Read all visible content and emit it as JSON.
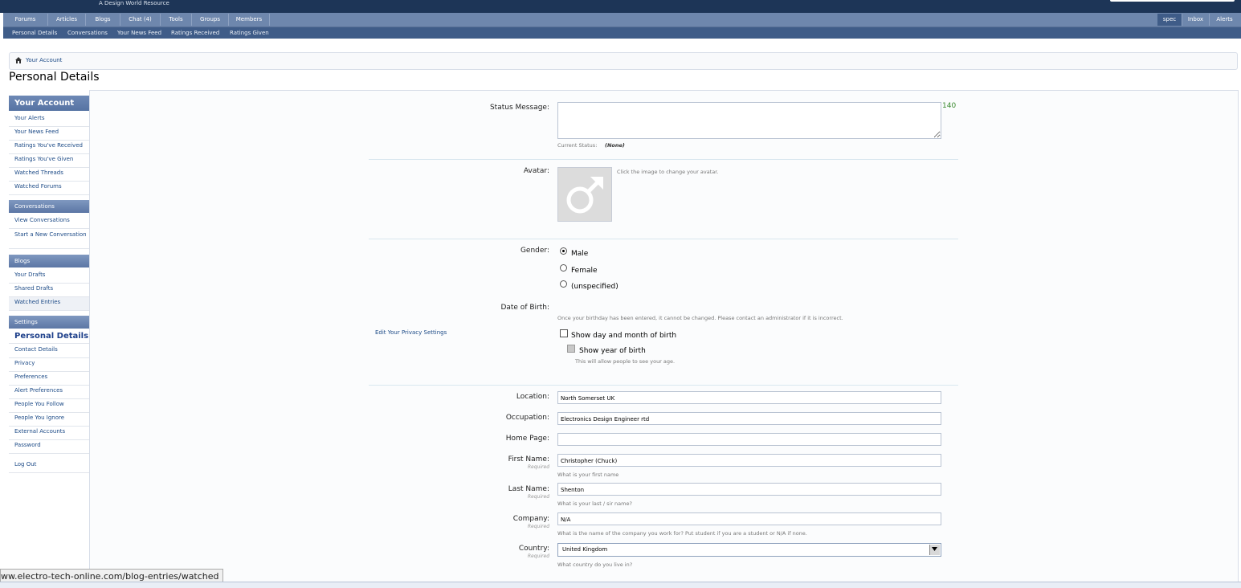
{
  "header": {
    "tagline": "A Design World Resource"
  },
  "nav": {
    "tabs": [
      "Forums",
      "Articles",
      "Blogs",
      "Chat (4)",
      "Tools",
      "Groups",
      "Members"
    ],
    "user_tabs": [
      "spec",
      "Inbox",
      "Alerts"
    ],
    "subnav": [
      "Personal Details",
      "Conversations",
      "Your News Feed",
      "Ratings Received",
      "Ratings Given"
    ]
  },
  "breadcrumb": {
    "label": "Your Account",
    "icon": "home-icon"
  },
  "page": {
    "title": "Personal Details"
  },
  "sidebar": {
    "heading": "Your Account",
    "account_items": [
      "Your Alerts",
      "Your News Feed",
      "Ratings You've Received",
      "Ratings You've Given",
      "Watched Threads",
      "Watched Forums"
    ],
    "conv_heading": "Conversations",
    "conv_items": [
      "View Conversations",
      "Start a New Conversation"
    ],
    "blogs_heading": "Blogs",
    "blog_items": [
      "Your Drafts",
      "Shared Drafts",
      "Watched Entries"
    ],
    "settings_heading": "Settings",
    "settings_selected": "Personal Details",
    "settings_items": [
      "Contact Details",
      "Privacy",
      "Preferences",
      "Alert Preferences",
      "People You Follow",
      "People You Ignore",
      "External Accounts",
      "Password"
    ],
    "logout": "Log Out"
  },
  "form": {
    "status_label": "Status Message:",
    "status_counter": "140",
    "current_status_label": "Current Status:",
    "current_status_value": "(None)",
    "avatar_label": "Avatar:",
    "avatar_hint": "Click the image to change your avatar.",
    "gender_label": "Gender:",
    "gender_options": [
      "Male",
      "Female",
      "(unspecified)"
    ],
    "gender_selected": "Male",
    "dob_label": "Date of Birth:",
    "dob_hint": "Once your birthday has been entered, it cannot be changed. Please contact an administrator if it is incorrect.",
    "privacy_link": "Edit Your Privacy Settings",
    "show_dm": "Show day and month of birth",
    "show_year": "Show year of birth",
    "show_year_hint": "This will allow people to see your age.",
    "location_label": "Location:",
    "location_value": "North Somerset UK",
    "occupation_label": "Occupation:",
    "occupation_value": "Electronics Design Engineer rtd",
    "homepage_label": "Home Page:",
    "homepage_value": "",
    "firstname_label": "First Name:",
    "firstname_value": "Christopher (Chuck)",
    "firstname_hint": "What is your first name",
    "lastname_label": "Last Name:",
    "lastname_value": "Shenton",
    "lastname_hint": "What is your last / sir name?",
    "company_label": "Company:",
    "company_value": "N/A",
    "company_hint": "What is the name of the company you work for? Put student if you are a student or N/A if none.",
    "country_label": "Country:",
    "country_value": "United Kingdom",
    "country_hint": "What country do you live in?",
    "required_label": "Required"
  },
  "statusbar": {
    "url": "ww.electro-tech-online.com/blog-entries/watched"
  },
  "colors": {
    "nav": "#6e87ad",
    "subnav": "#3f5c88",
    "topbar": "#1d3557",
    "counter": "#3a8a2f"
  }
}
